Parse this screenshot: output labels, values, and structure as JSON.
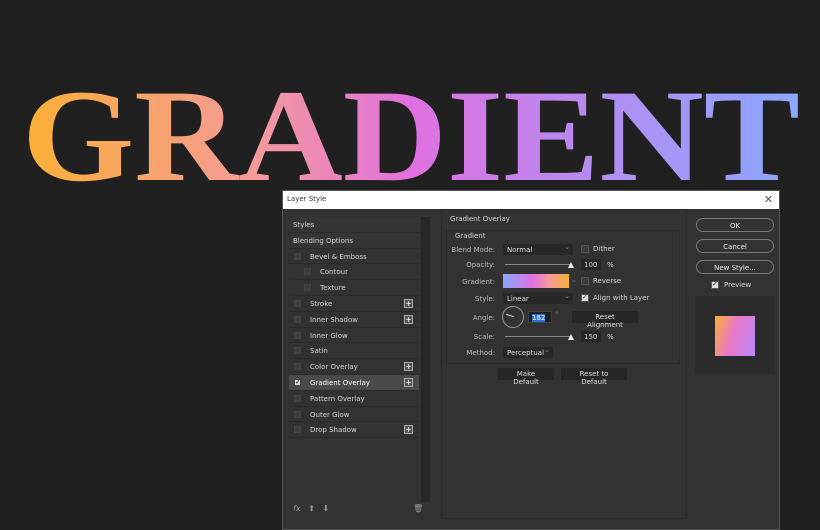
{
  "hero": {
    "text": "GRADIENT",
    "colors": [
      "#fbb034",
      "#f28fb0",
      "#e070e0",
      "#b88af0",
      "#8aa8ff"
    ]
  },
  "dialog": {
    "title": "Layer Style",
    "left": {
      "items": [
        {
          "label": "Styles",
          "type": "hdr"
        },
        {
          "label": "Blending Options",
          "type": "hdr"
        },
        {
          "label": "Bevel & Emboss",
          "checked": false,
          "plus": false
        },
        {
          "label": "Contour",
          "checked": false,
          "sub": true
        },
        {
          "label": "Texture",
          "checked": false,
          "sub": true
        },
        {
          "label": "Stroke",
          "checked": false,
          "plus": true
        },
        {
          "label": "Inner Shadow",
          "checked": false,
          "plus": true
        },
        {
          "label": "Inner Glow",
          "checked": false
        },
        {
          "label": "Satin",
          "checked": false
        },
        {
          "label": "Color Overlay",
          "checked": false,
          "plus": true
        },
        {
          "label": "Gradient Overlay",
          "checked": true,
          "plus": true,
          "selected": true
        },
        {
          "label": "Pattern Overlay",
          "checked": false
        },
        {
          "label": "Outer Glow",
          "checked": false
        },
        {
          "label": "Drop Shadow",
          "checked": false,
          "plus": true
        }
      ],
      "fx": "fx"
    },
    "panel": {
      "section": "Gradient Overlay",
      "group": "Gradient",
      "blend_label": "Blend Mode:",
      "blend_value": "Normal",
      "dither": "Dither",
      "opacity_label": "Opacity:",
      "opacity": "100",
      "pct": "%",
      "gradient_label": "Gradient:",
      "reverse": "Reverse",
      "style_label": "Style:",
      "style_value": "Linear",
      "align": "Align with Layer",
      "angle_label": "Angle:",
      "angle": "162",
      "deg": "°",
      "reset_align": "Reset Alignment",
      "scale_label": "Scale:",
      "scale": "150",
      "method_label": "Method:",
      "method_value": "Perceptual",
      "make_default": "Make Default",
      "reset_default": "Reset to Default"
    },
    "right": {
      "ok": "OK",
      "cancel": "Cancel",
      "new_style": "New Style...",
      "preview": "Preview"
    }
  }
}
